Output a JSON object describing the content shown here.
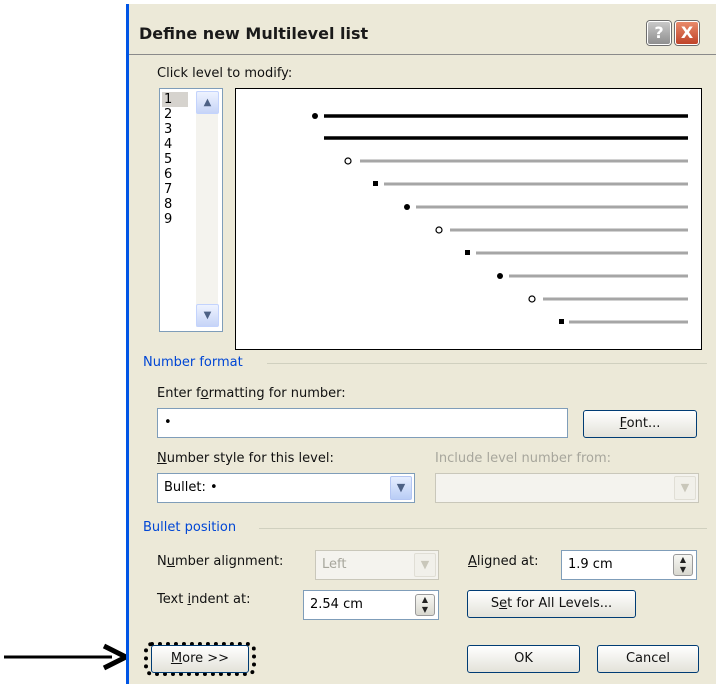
{
  "dialog": {
    "title": "Define new Multilevel list",
    "help_symbol": "?",
    "close_symbol": "X"
  },
  "level_section": {
    "label": "Click level to modify:",
    "levels": [
      "1",
      "2",
      "3",
      "4",
      "5",
      "6",
      "7",
      "8",
      "9"
    ],
    "selected_level": "1"
  },
  "number_format": {
    "section_label": "Number format",
    "enter_label": "Enter formatting for number:",
    "format_value": "•",
    "font_button": "Font...",
    "style_label": "Number style for this level:",
    "style_value": "Bullet: •",
    "include_label": "Include level number from:",
    "include_value": ""
  },
  "bullet_position": {
    "section_label": "Bullet position",
    "alignment_label": "Number alignment:",
    "alignment_value": "Left",
    "aligned_at_label": "Aligned at:",
    "aligned_at_value": "1.9 cm",
    "indent_label": "Text indent at:",
    "indent_value": "2.54 cm",
    "set_all_button": "Set for All Levels..."
  },
  "buttons": {
    "more": "More >>",
    "ok": "OK",
    "cancel": "Cancel"
  },
  "icons": [
    "question-icon",
    "close-icon",
    "scroll-up-icon",
    "scroll-down-icon",
    "dropdown-arrow-icon",
    "spinner-icon",
    "callout-arrow-icon"
  ],
  "colors": {
    "dialog_bg": "#ece9d8",
    "section_blue": "#0046d5",
    "close_red": "#c0442a"
  }
}
